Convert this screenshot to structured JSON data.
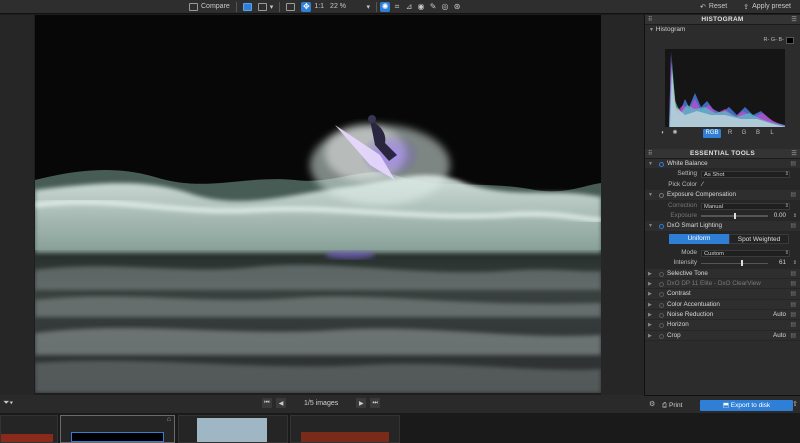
{
  "toolbar": {
    "compare_label": "Compare",
    "one_to_one_label": "1:1",
    "zoom_value": "22 %",
    "reset_label": "Reset",
    "apply_preset_label": "Apply preset"
  },
  "nav": {
    "image_count": "1/5 images"
  },
  "histogram": {
    "panel_title": "HISTOGRAM",
    "section_label": "Histogram",
    "channel_hint": "R- G- B-",
    "channels": [
      "RGB",
      "R",
      "G",
      "B",
      "L"
    ],
    "active_channel": "RGB"
  },
  "essential": {
    "panel_title": "ESSENTIAL TOOLS",
    "white_balance": {
      "label": "White Balance",
      "setting_label": "Setting",
      "setting_value": "As Shot",
      "pick_color_label": "Pick Color"
    },
    "exposure": {
      "label": "Exposure Compensation",
      "correction_label": "Correction",
      "correction_value": "Manual",
      "exposure_label": "Exposure",
      "exposure_value": "0.00",
      "exposure_fraction": 0.5
    },
    "smart_lighting": {
      "label": "DxO Smart Lighting",
      "mode_options": [
        "Uniform",
        "Spot Weighted"
      ],
      "active_mode": "Uniform",
      "mode_label": "Mode",
      "mode_value": "Custom",
      "intensity_label": "Intensity",
      "intensity_value": "61",
      "intensity_fraction": 0.61
    },
    "tools": [
      {
        "label": "Selective Tone",
        "value": "",
        "dim": false
      },
      {
        "label": "DxO DP 11 Elite - DxO ClearView",
        "value": "",
        "dim": true
      },
      {
        "label": "Contrast",
        "value": "",
        "dim": false
      },
      {
        "label": "Color Accentuation",
        "value": "",
        "dim": false
      },
      {
        "label": "Noise Reduction",
        "value": "Auto",
        "dim": false
      },
      {
        "label": "Horizon",
        "value": "",
        "dim": false
      },
      {
        "label": "Crop",
        "value": "Auto",
        "dim": false
      }
    ]
  },
  "export": {
    "print_label": "Print",
    "export_label": "Export to disk"
  },
  "colors": {
    "accent": "#2f7fd6",
    "panel_bg": "#2c2c2c"
  }
}
